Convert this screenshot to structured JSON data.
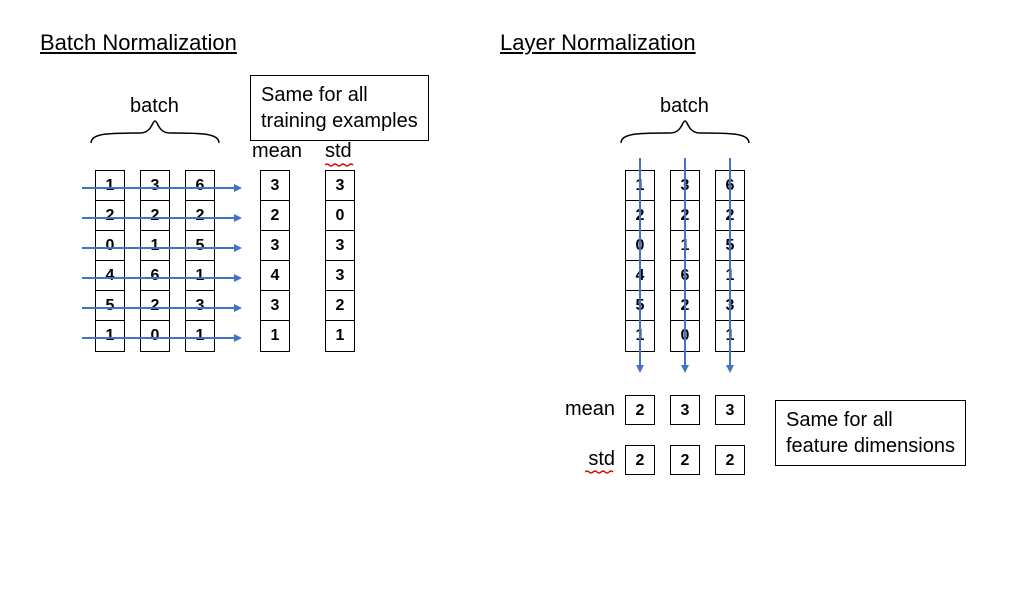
{
  "titles": {
    "bn": "Batch Normalization",
    "ln": "Layer Normalization"
  },
  "labels": {
    "batch": "batch",
    "mean": "mean",
    "std": "std"
  },
  "notes": {
    "bn_line1": "Same for all",
    "bn_line2": "training examples",
    "ln_line1": "Same for all",
    "ln_line2": "feature dimensions"
  },
  "bn": {
    "batch": [
      [
        1,
        2,
        0,
        4,
        5,
        1
      ],
      [
        3,
        2,
        1,
        6,
        2,
        0
      ],
      [
        6,
        2,
        5,
        1,
        3,
        1
      ]
    ],
    "mean": [
      3,
      2,
      3,
      4,
      3,
      1
    ],
    "std": [
      3,
      0,
      3,
      3,
      2,
      1
    ]
  },
  "ln": {
    "batch": [
      [
        1,
        2,
        0,
        4,
        5,
        1
      ],
      [
        3,
        2,
        1,
        6,
        2,
        0
      ],
      [
        6,
        2,
        5,
        1,
        3,
        1
      ]
    ],
    "mean": [
      2,
      3,
      3
    ],
    "std": [
      2,
      2,
      2
    ]
  },
  "chart_data": {
    "type": "table",
    "title": "Batch Normalization vs Layer Normalization illustration",
    "batch_matrix_columns": [
      [
        1,
        2,
        0,
        4,
        5,
        1
      ],
      [
        3,
        2,
        1,
        6,
        2,
        0
      ],
      [
        6,
        2,
        5,
        1,
        3,
        1
      ]
    ],
    "batch_norm": {
      "axis": "across batch (rows)",
      "mean_per_feature": [
        3,
        2,
        3,
        4,
        3,
        1
      ],
      "std_per_feature": [
        3,
        0,
        3,
        3,
        2,
        1
      ],
      "note": "Same for all training examples"
    },
    "layer_norm": {
      "axis": "across features (columns)",
      "mean_per_example": [
        2,
        3,
        3
      ],
      "std_per_example": [
        2,
        2,
        2
      ],
      "note": "Same for all feature dimensions"
    }
  }
}
